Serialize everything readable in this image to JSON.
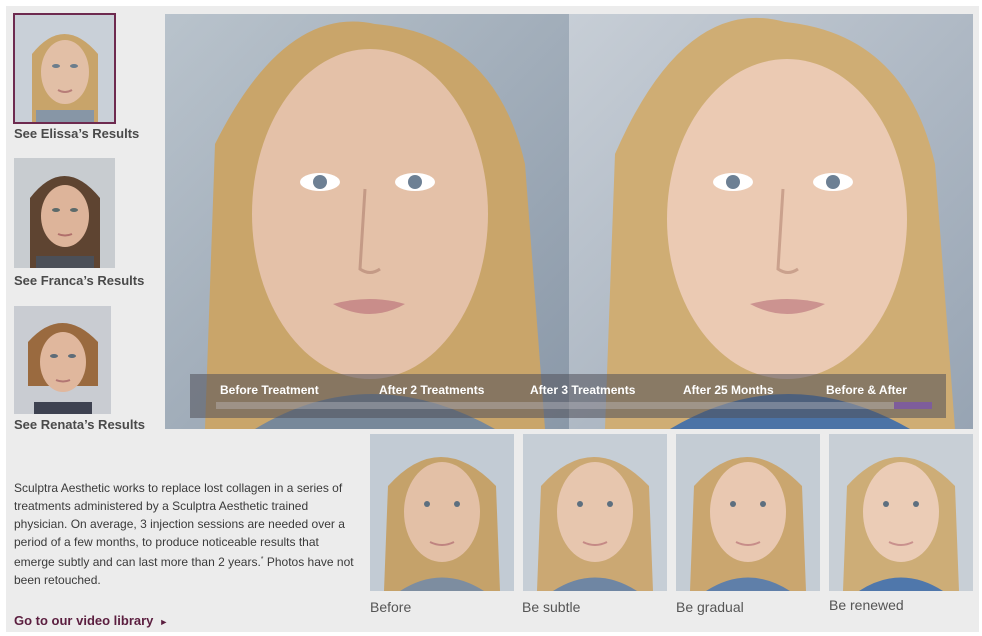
{
  "sidebar": {
    "items": [
      {
        "label": "See Elissa’s Results",
        "selected": true
      },
      {
        "label": "See Franca’s Results",
        "selected": false
      },
      {
        "label": "See Renata’s Results",
        "selected": false
      }
    ]
  },
  "hero": {
    "tabs": [
      {
        "label": "Before Treatment"
      },
      {
        "label": "After 2 Treatments"
      },
      {
        "label": "After 3 Treatments"
      },
      {
        "label": "After 25 Months"
      },
      {
        "label": "Before & After"
      }
    ],
    "slider_position_fraction": 1.0
  },
  "gallery": {
    "items": [
      {
        "caption": "Before"
      },
      {
        "caption": "Be subtle"
      },
      {
        "caption": "Be gradual"
      },
      {
        "caption": "Be renewed"
      }
    ]
  },
  "description": {
    "text": "Sculptra Aesthetic works to replace lost collagen in a series of treatments administered by a Sculptra Aesthetic trained physician. On average, 3 injection sessions are needed over a period of a few months, to produce noticeable results that emerge subtly and can last more than 2 years.",
    "footnote_mark": "*",
    "note": " Photos have not been retouched."
  },
  "video_link": {
    "label": "Go to our video library",
    "icon": "right-triangle-arrow-icon"
  },
  "colors": {
    "accent": "#5b1e3f",
    "selected_border": "#6e2a4f",
    "slider_handle": "#7e5d9b"
  }
}
